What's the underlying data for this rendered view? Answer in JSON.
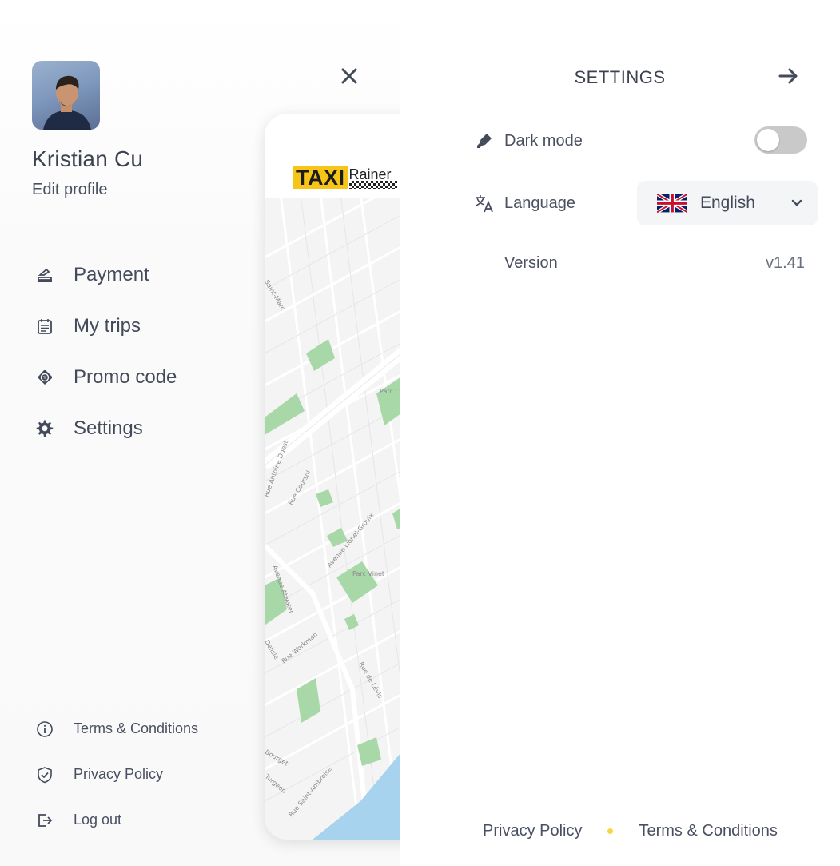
{
  "drawer": {
    "profile": {
      "name": "Kristian Cu",
      "edit_label": "Edit profile"
    },
    "close_icon": "close-icon",
    "menu": [
      {
        "label": "Payment",
        "icon": "payment-icon"
      },
      {
        "label": "My trips",
        "icon": "calendar-icon"
      },
      {
        "label": "Promo code",
        "icon": "promo-tag-icon"
      },
      {
        "label": "Settings",
        "icon": "gear-icon"
      }
    ],
    "footer": [
      {
        "label": "Terms & Conditions",
        "icon": "info-icon"
      },
      {
        "label": "Privacy Policy",
        "icon": "shield-check-icon"
      },
      {
        "label": "Log out",
        "icon": "logout-icon"
      }
    ]
  },
  "map_preview": {
    "logo_taxi": "TAXI",
    "logo_rainer": "Rainer",
    "street_labels": [
      "Saint-Marc",
      "Rue Antoine Duest",
      "Rue Coursol",
      "Avenue Lionel-Groulx",
      "Parc Vinet",
      "Avenue Atwater",
      "Rue Workman",
      "Delisle",
      "Rue de Lévis",
      "Rue Saint-Ambroise",
      "Turgeon",
      "Bourget",
      "Parc C.-C"
    ]
  },
  "settings": {
    "title": "SETTINGS",
    "back_icon": "arrow-right-icon",
    "dark_mode": {
      "label": "Dark mode",
      "icon": "pen-icon",
      "enabled": false
    },
    "language": {
      "label": "Language",
      "icon": "translate-icon",
      "value": "English",
      "flag": "uk-flag-icon"
    },
    "version": {
      "label": "Version",
      "value": "v1.41"
    },
    "bottom_links": {
      "privacy": "Privacy Policy",
      "terms": "Terms & Conditions"
    }
  },
  "colors": {
    "text": "#4a5061",
    "heading": "#3c4250",
    "toggle_off": "#c9c9c9",
    "select_bg": "#f4f5f7",
    "accent_dot": "#f9d63b",
    "taxi_yellow": "#f7c517"
  }
}
